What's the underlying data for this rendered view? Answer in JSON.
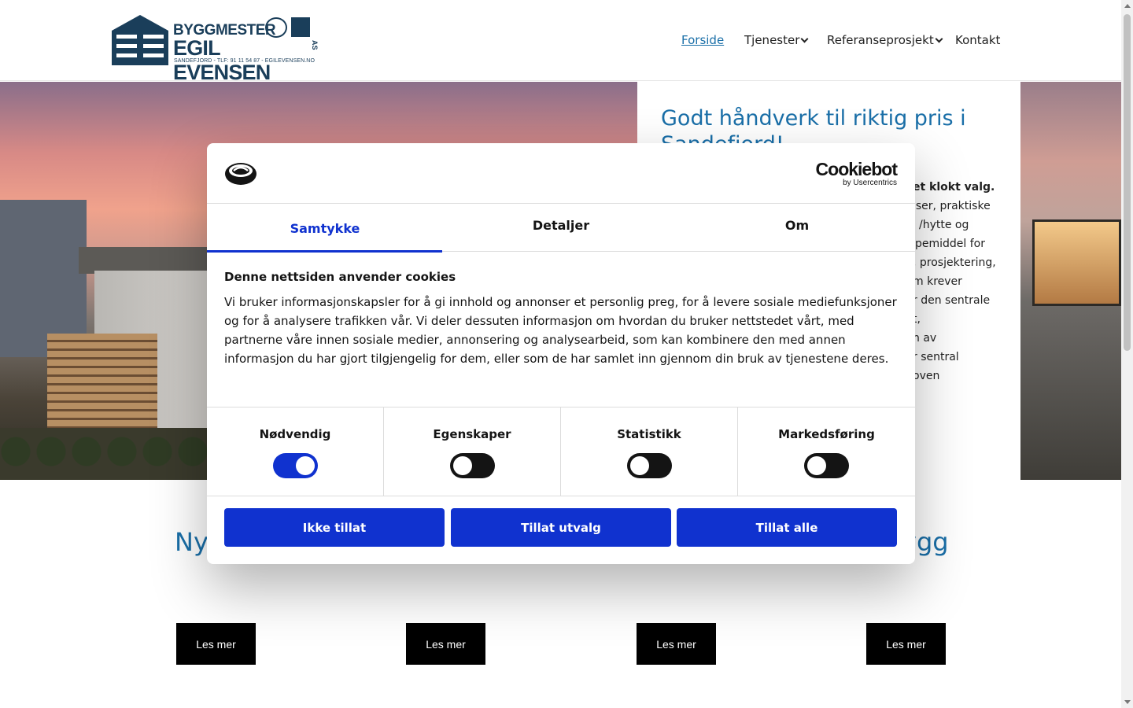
{
  "header": {
    "logo": {
      "line1": "BYGGMESTER",
      "line2": "EGIL EVENSEN",
      "suffix": "AS",
      "sub": "SANDEFJORD - TLF: 91 11 54 87 - EGILEVENSEN.NO"
    },
    "nav": [
      {
        "label": "Forside",
        "active": true
      },
      {
        "label": "Tjenester",
        "dropdown": true
      },
      {
        "label": "Referanseprosjekt",
        "dropdown": true
      },
      {
        "label": "Kontakt"
      }
    ]
  },
  "hero": {
    "title": "Godt håndverk til riktig pris i Sandefjord!",
    "text_lines": [
      "et klokt valg.",
      "iser, praktiske",
      "/hytte og",
      "pemiddel for",
      ", prosjektering,",
      "m krever",
      "r den sentrale",
      "t,",
      "n av",
      "r sentral",
      "oven"
    ]
  },
  "section": {
    "title_left": "Nyb",
    "title_right": "ygg"
  },
  "cards": [
    {
      "button": "Les mer"
    },
    {
      "button": "Les mer"
    },
    {
      "button": "Les mer"
    },
    {
      "button": "Les mer"
    }
  ],
  "cookie_dialog": {
    "brand": {
      "name": "Cookiebot",
      "by": "by Usercentrics"
    },
    "tabs": [
      {
        "label": "Samtykke",
        "active": true
      },
      {
        "label": "Detaljer"
      },
      {
        "label": "Om"
      }
    ],
    "heading": "Denne nettsiden anvender cookies",
    "body": "Vi bruker informasjonskapsler for å gi innhold og annonser et personlig preg, for å levere sosiale mediefunksjoner og for å analysere trafikken vår. Vi deler dessuten informasjon om hvordan du bruker nettstedet vårt, med partnerne våre innen sosiale medier, annonsering og analysearbeid, som kan kombinere den med annen informasjon du har gjort tilgjengelig for dem, eller som de har samlet inn gjennom din bruk av tjenestene deres.",
    "categories": [
      {
        "label": "Nødvendig",
        "enabled": true
      },
      {
        "label": "Egenskaper",
        "enabled": false
      },
      {
        "label": "Statistikk",
        "enabled": false
      },
      {
        "label": "Markedsføring",
        "enabled": false
      }
    ],
    "buttons": {
      "deny": "Ikke tillat",
      "selection": "Tillat utvalg",
      "allow_all": "Tillat alle"
    }
  },
  "colors": {
    "cookiebot_blue": "#1032cf",
    "site_blue": "#1a6fa8",
    "logo_navy": "#1a3e5a"
  }
}
